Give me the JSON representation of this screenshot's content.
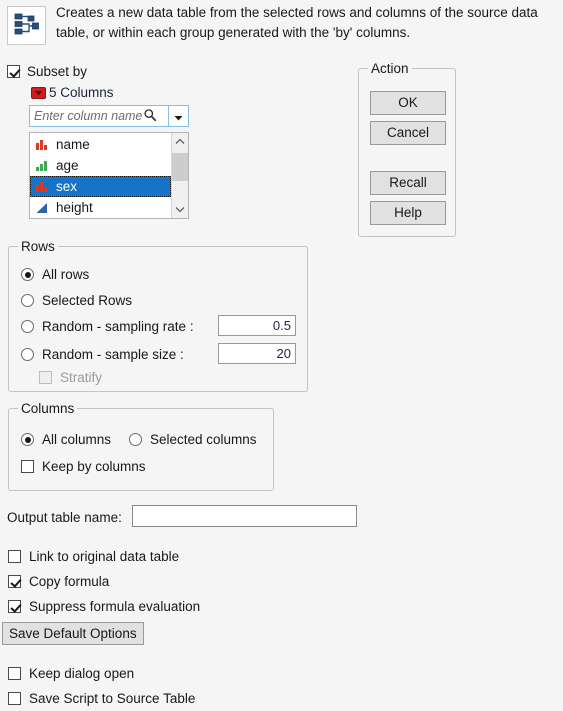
{
  "header": {
    "icon": "subset-table-icon",
    "description": "Creates a new data table from the selected rows and columns of the source data table, or within each group generated with the 'by' columns."
  },
  "subset_by": {
    "label": "Subset by",
    "checked": true,
    "column_count_label": "5 Columns",
    "menu_icon": "red-triangle-menu-icon",
    "search": {
      "placeholder": "Enter column name",
      "value": "",
      "search_icon": "search-icon",
      "dropdown_icon": "chevron-down-icon"
    },
    "columns": [
      {
        "name": "name",
        "type": "nominal",
        "icon": "nominal-red-bars-icon",
        "selected": false
      },
      {
        "name": "age",
        "type": "ordinal",
        "icon": "ordinal-green-bars-icon",
        "selected": false
      },
      {
        "name": "sex",
        "type": "nominal",
        "icon": "nominal-red-bars-icon",
        "selected": true
      },
      {
        "name": "height",
        "type": "continuous",
        "icon": "continuous-blue-triangle-icon",
        "selected": false
      }
    ]
  },
  "action": {
    "title": "Action",
    "ok_label": "OK",
    "cancel_label": "Cancel",
    "recall_label": "Recall",
    "help_label": "Help"
  },
  "rows": {
    "title": "Rows",
    "options": [
      {
        "label": "All rows",
        "selected": true
      },
      {
        "label": "Selected Rows",
        "selected": false
      },
      {
        "label": "Random - sampling rate :",
        "selected": false
      },
      {
        "label": "Random - sample size :",
        "selected": false
      }
    ],
    "sampling_rate_value": "0.5",
    "sample_size_value": "20",
    "stratify": {
      "label": "Stratify",
      "checked": false,
      "disabled": true
    }
  },
  "columns_section": {
    "title": "Columns",
    "all_columns_label": "All columns",
    "all_columns_selected": true,
    "selected_columns_label": "Selected columns",
    "selected_columns_selected": false,
    "keep_by_columns_label": "Keep by columns",
    "keep_by_columns_checked": false
  },
  "output": {
    "label": "Output table name:",
    "value": "",
    "placeholder": ""
  },
  "options": {
    "link_label": "Link to original data table",
    "link_checked": false,
    "copy_formula_label": "Copy formula",
    "copy_formula_checked": true,
    "suppress_label": "Suppress formula evaluation",
    "suppress_checked": true,
    "save_defaults_label": "Save Default Options",
    "keep_dialog_label": "Keep dialog open",
    "keep_dialog_checked": false,
    "save_script_label": "Save Script to Source Table",
    "save_script_checked": false
  },
  "colors": {
    "background": "#f5f5f5",
    "selection_blue": "#1673c8",
    "menu_red": "#d01f1f",
    "nominal_red": "#d93a24",
    "ordinal_green": "#3faa56",
    "continuous_blue": "#2a63a8",
    "button_face": "#e1e1e1"
  }
}
